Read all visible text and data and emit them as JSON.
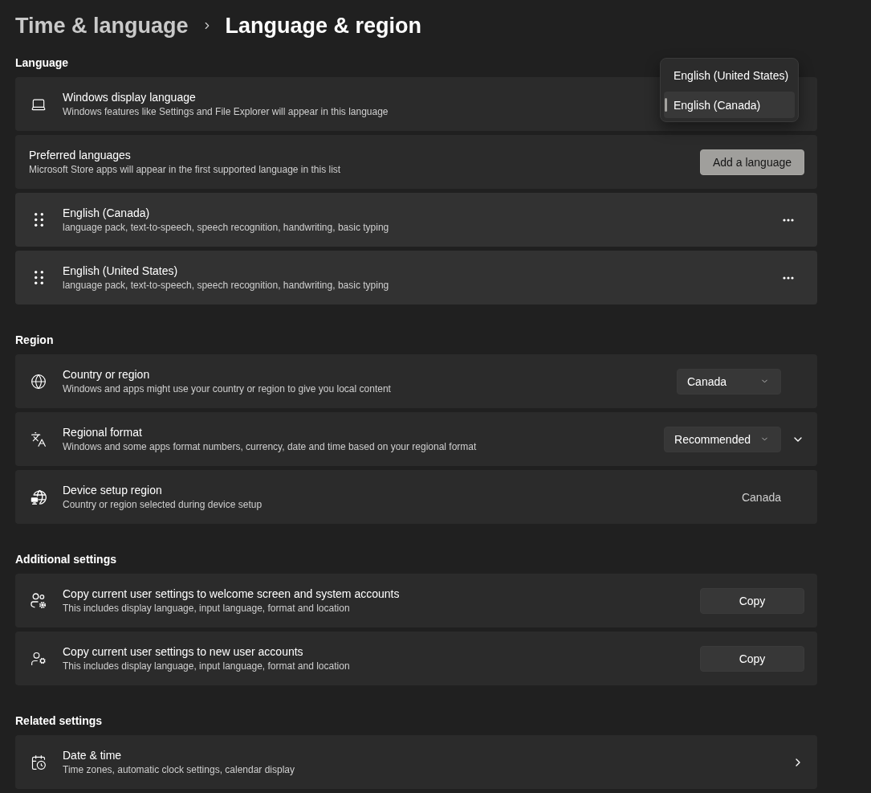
{
  "breadcrumb": [
    {
      "label": "Time & language",
      "current": false
    },
    {
      "label": "Language & region",
      "current": true
    }
  ],
  "sections": [
    {
      "heading": "Language",
      "items": [
        {
          "kind": "dropdown",
          "title": "Windows display language",
          "description": "Windows features like Settings and File Explorer will appear in this language",
          "dropdown": {
            "open": true,
            "options": [
              {
                "label": "English (United States)",
                "selected": false
              },
              {
                "label": "English (Canada)",
                "selected": true
              }
            ]
          }
        },
        {
          "kind": "button",
          "title": "Preferred languages",
          "description": "Microsoft Store apps will appear in the first supported language in this list",
          "button": {
            "label": "Add a language",
            "accent": true
          }
        },
        {
          "kind": "language",
          "title": "English (Canada)",
          "description": "language pack, text-to-speech, speech recognition, handwriting, basic typing"
        },
        {
          "kind": "language",
          "title": "English (United States)",
          "description": "language pack, text-to-speech, speech recognition, handwriting, basic typing"
        }
      ]
    },
    {
      "heading": "Region",
      "items": [
        {
          "kind": "combobox",
          "title": "Country or region",
          "description": "Windows and apps might use your country or region to give you local content",
          "value": "Canada"
        },
        {
          "kind": "combobox",
          "title": "Regional format",
          "description": "Windows and some apps format numbers, currency, date and time based on your regional format",
          "value": "Recommended",
          "expanded": false
        },
        {
          "kind": "value",
          "title": "Device setup region",
          "description": "Country or region selected during device setup",
          "value": "Canada"
        }
      ]
    },
    {
      "heading": "Additional settings",
      "items": [
        {
          "kind": "button",
          "title": "Copy current user settings to welcome screen and system accounts",
          "description": "This includes display language, input language, format and location",
          "button": {
            "label": "Copy",
            "accent": false
          }
        },
        {
          "kind": "button",
          "title": "Copy current user settings to new user accounts",
          "description": "This includes display language, input language, format and location",
          "button": {
            "label": "Copy",
            "accent": false
          }
        }
      ]
    },
    {
      "heading": "Related settings",
      "items": [
        {
          "kind": "link",
          "title": "Date & time",
          "description": "Time zones, automatic clock settings, calendar display"
        }
      ]
    }
  ]
}
